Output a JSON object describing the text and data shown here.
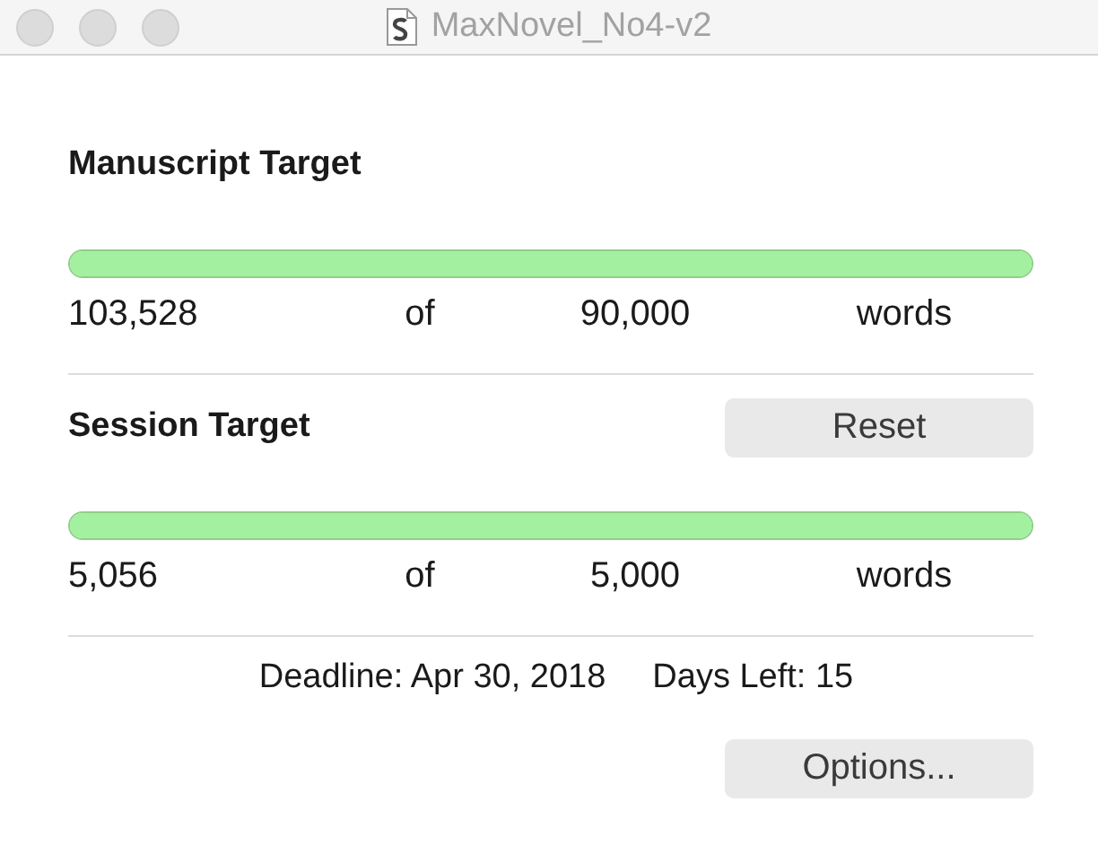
{
  "window": {
    "title": "MaxNovel_No4-v2"
  },
  "manuscript_target": {
    "heading": "Manuscript Target",
    "level": 1,
    "count": "103,528",
    "of": "of",
    "target": "90,000",
    "unit": "words"
  },
  "session_target": {
    "heading": "Session Target",
    "reset_button": "Reset",
    "level": 1,
    "count": "5,056",
    "of": "of",
    "target": "5,000",
    "unit": "words"
  },
  "deadline": "Deadline: Apr 30, 2018",
  "days_left": "Days Left: 15",
  "options_button": "Options..."
}
